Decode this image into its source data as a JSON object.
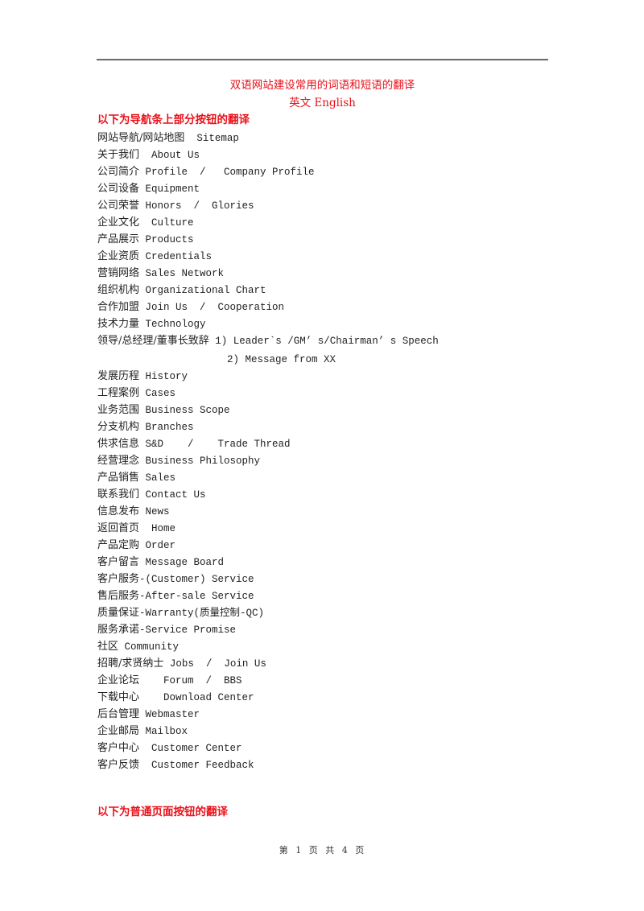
{
  "document": {
    "title": "双语网站建设常用的词语和短语的翻译",
    "subtitle": "英文 English",
    "colors": {
      "heading": "#e8101a",
      "body": "#222222"
    },
    "section1_heading": "以下为导航条上部分按钮的翻译",
    "entries": [
      {
        "zh": "网站导航/网站地图",
        "en": "  Sitemap"
      },
      {
        "zh": "关于我们",
        "en": "  About Us"
      },
      {
        "zh": "公司简介",
        "en": " Profile  /   Company Profile"
      },
      {
        "zh": "公司设备",
        "en": " Equipment"
      },
      {
        "zh": "公司荣誉",
        "en": " Honors  /  Glories"
      },
      {
        "zh": "企业文化",
        "en": "  Culture"
      },
      {
        "zh": "产品展示",
        "en": " Products"
      },
      {
        "zh": "企业资质",
        "en": " Credentials"
      },
      {
        "zh": "营销网络",
        "en": " Sales Network"
      },
      {
        "zh": "组织机构",
        "en": " Organizational Chart"
      },
      {
        "zh": "合作加盟",
        "en": " Join Us  /  Cooperation"
      },
      {
        "zh": "技术力量",
        "en": " Technology"
      },
      {
        "zh": "领导/总经理/董事长致辞",
        "en": " 1) Leader`s /GM’ s/Chairman’ s Speech"
      },
      {
        "zh": "",
        "en": "2) Message from XX"
      },
      {
        "zh": "发展历程",
        "en": " History"
      },
      {
        "zh": "工程案例",
        "en": " Cases"
      },
      {
        "zh": "业务范围",
        "en": " Business Scope"
      },
      {
        "zh": "分支机构",
        "en": " Branches"
      },
      {
        "zh": "供求信息",
        "en": " S&D    /    Trade Thread"
      },
      {
        "zh": "经营理念",
        "en": " Business Philosophy"
      },
      {
        "zh": "产品销售",
        "en": " Sales"
      },
      {
        "zh": "联系我们",
        "en": " Contact Us"
      },
      {
        "zh": "信息发布",
        "en": " News"
      },
      {
        "zh": "返回首页",
        "en": "  Home"
      },
      {
        "zh": "产品定购",
        "en": " Order"
      },
      {
        "zh": "客户留言",
        "en": " Message Board"
      },
      {
        "zh": "客户服务",
        "en": "-(Customer) Service"
      },
      {
        "zh": "售后服务",
        "en": "-After-sale Service"
      },
      {
        "zh": "质量保证",
        "en": "-Warranty(质量控制-QC)"
      },
      {
        "zh": "服务承诺",
        "en": "-Service Promise"
      },
      {
        "zh": "社区",
        "en": " Community"
      },
      {
        "zh": "招聘/求贤纳士",
        "en": " Jobs  /  Join Us"
      },
      {
        "zh": "企业论坛",
        "en": "    Forum  /  BBS"
      },
      {
        "zh": "下载中心",
        "en": "    Download Center"
      },
      {
        "zh": "后台管理",
        "en": " Webmaster"
      },
      {
        "zh": "企业邮局",
        "en": " Mailbox"
      },
      {
        "zh": "客户中心",
        "en": "  Customer Center"
      },
      {
        "zh": "客户反馈",
        "en": "  Customer Feedback"
      }
    ],
    "section2_heading": "以下为普通页面按钮的翻译",
    "footer": "第 1 页 共 4 页"
  }
}
